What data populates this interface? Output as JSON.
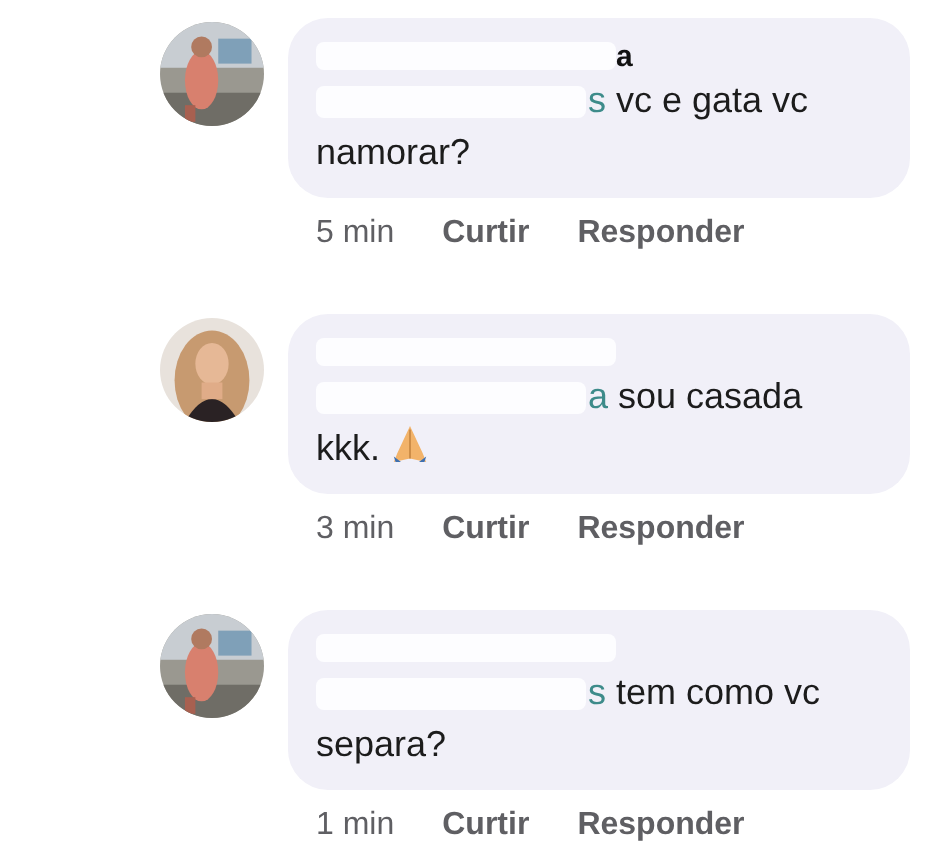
{
  "comments": [
    {
      "author": "a",
      "mention": "s",
      "text": " vc e gata vc namorar?",
      "time": "5 min",
      "actions": [
        "Curtir",
        "Responder"
      ]
    },
    {
      "mention": "a",
      "text": " sou casada kkk.",
      "emoji": true,
      "time": "3 min",
      "actions": [
        "Curtir",
        "Responder"
      ]
    },
    {
      "mention": "s",
      "text": " tem como vc separa?",
      "time": "1 min",
      "actions": [
        "Curtir",
        "Responder"
      ]
    }
  ]
}
